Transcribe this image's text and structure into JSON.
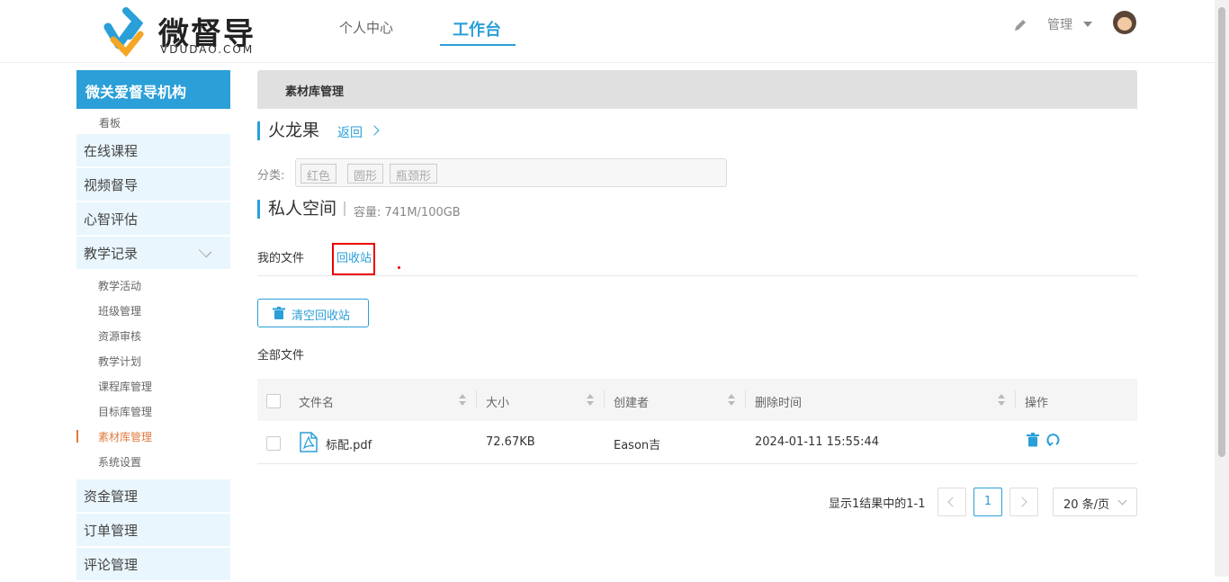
{
  "header": {
    "logo_title": "微督导",
    "logo_subtitle": "VDUDAO.COM",
    "nav": [
      "个人中心",
      "工作台"
    ],
    "admin_label": "管理"
  },
  "sidebar": {
    "org_name": "微关爱督导机构",
    "kanban": "看板",
    "top_menus": [
      "在线课程",
      "视频督导",
      "心智评估",
      "教学记录"
    ],
    "teaching_sub": [
      "教学活动",
      "班级管理",
      "资源审核",
      "教学计划",
      "课程库管理",
      "目标库管理",
      "素材库管理",
      "系统设置"
    ],
    "bottom_menus": [
      "资金管理",
      "订单管理",
      "评论管理"
    ]
  },
  "main": {
    "breadcrumb": "素材库管理",
    "item_title": "火龙果",
    "back_label": "返回",
    "category_label": "分类:",
    "tags": [
      "红色",
      "圆形",
      "瓶颈形"
    ],
    "space_title": "私人空间",
    "capacity": "容量: 741M/100GB",
    "tabs": [
      "我的文件",
      "回收站"
    ],
    "clear_button": "清空回收站",
    "all_files": "全部文件",
    "table": {
      "headers": [
        "文件名",
        "大小",
        "创建者",
        "删除时间",
        "操作"
      ],
      "rows": [
        {
          "name": "标配.pdf",
          "size": "72.67KB",
          "creator": "Eason吉",
          "deleted": "2024-01-11 15:55:44"
        }
      ]
    },
    "pagination": {
      "info": "显示1结果中的1-1",
      "current": "1",
      "page_size": "20 条/页"
    }
  },
  "colors": {
    "accent": "#2a9fd8",
    "active_sub": "#e07a3e"
  }
}
